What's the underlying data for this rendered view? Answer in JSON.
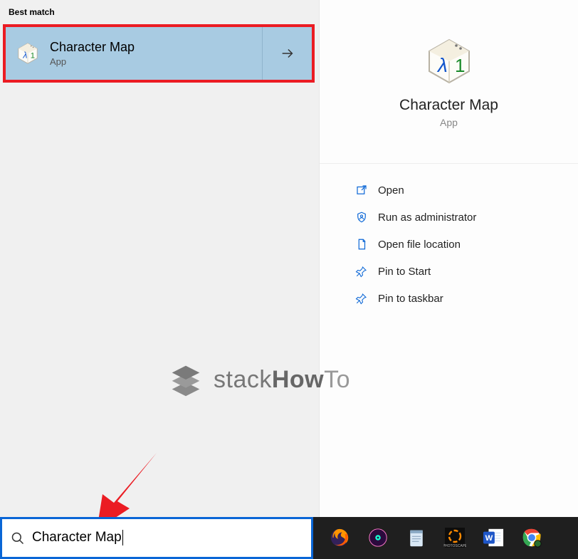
{
  "left": {
    "section_label": "Best match",
    "result": {
      "title": "Character Map",
      "subtitle": "App"
    }
  },
  "right": {
    "title": "Character Map",
    "subtitle": "App",
    "actions": [
      {
        "label": "Open"
      },
      {
        "label": "Run as administrator"
      },
      {
        "label": "Open file location"
      },
      {
        "label": "Pin to Start"
      },
      {
        "label": "Pin to taskbar"
      }
    ]
  },
  "watermark": {
    "part1": "stack",
    "part2": "How",
    "part3": "To"
  },
  "search": {
    "value": "Character Map"
  }
}
